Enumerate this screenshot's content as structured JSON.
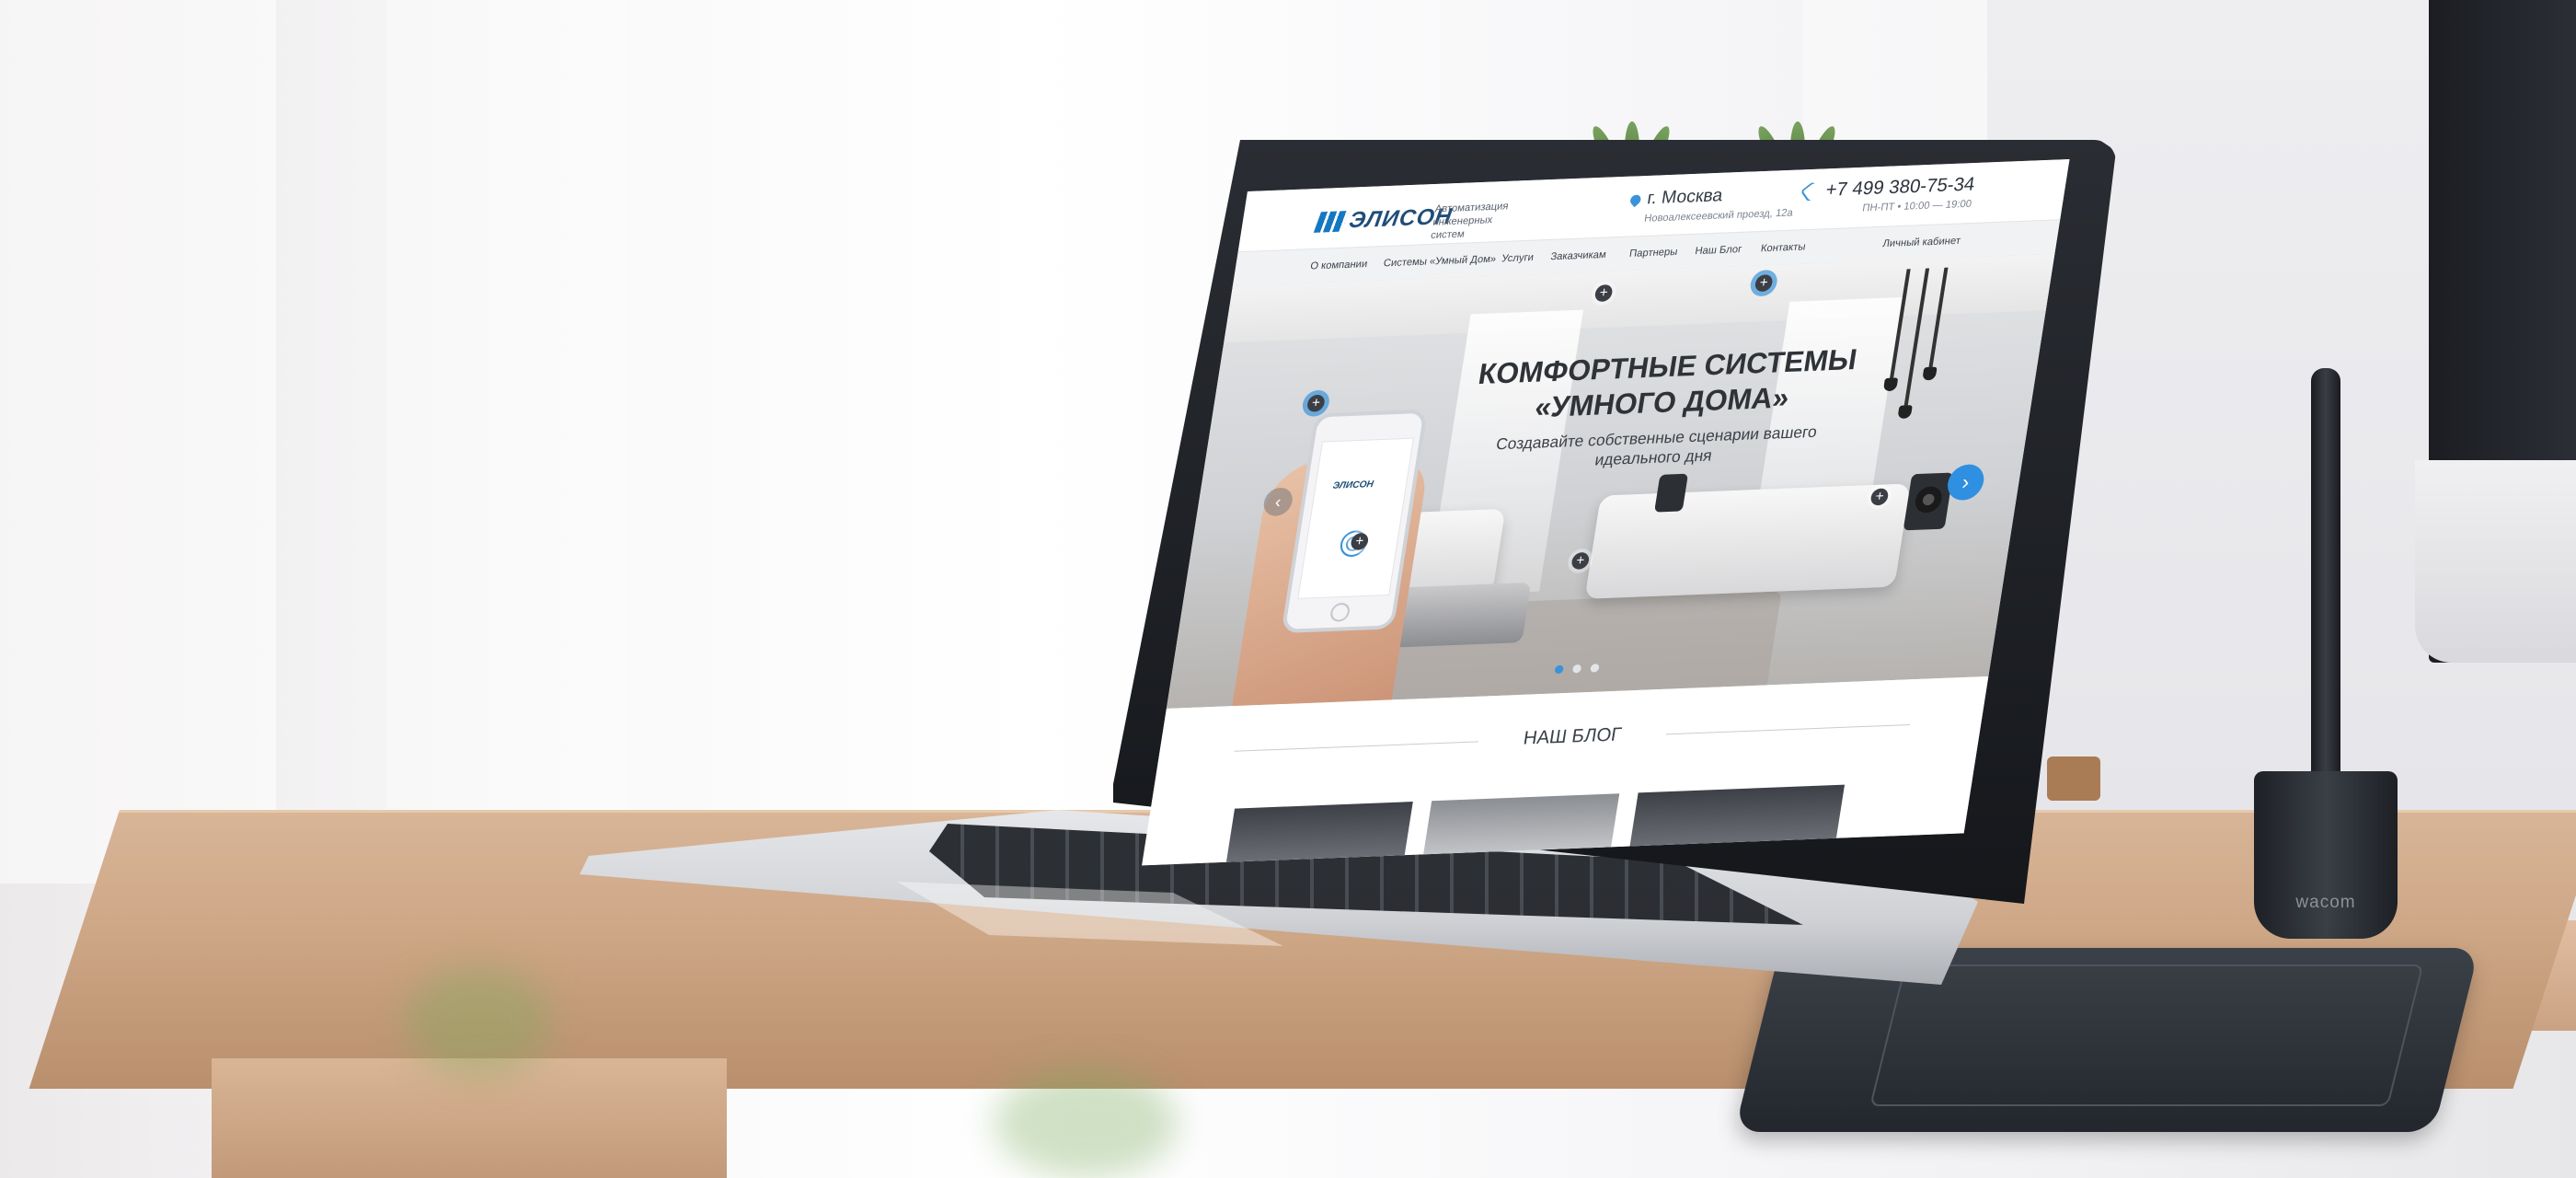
{
  "site": {
    "brand": "ЭЛИСОН",
    "tagline": "Автоматизация инженерных систем",
    "city": "г. Москва",
    "address": "Новоалексеевский проезд, 12а",
    "phone": "+7 499 380-75-34",
    "hours": "ПН-ПТ • 10:00 — 19:00",
    "nav": [
      "О компании",
      "Системы «Умный Дом»",
      "Услуги",
      "Заказчикам",
      "Партнеры",
      "Наш Блог",
      "Контакты"
    ],
    "account": "Личный кабинет",
    "hero": {
      "title": "КОМФОРТНЫЕ СИСТЕМЫ «УМНОГО ДОМА»",
      "subtitle": "Создавайте собственные сценарии вашего идеального дня",
      "phone_brand": "ЭЛИСОН",
      "slides_total": 3,
      "slide_active": 1
    },
    "blog_title": "НАШ БЛОГ"
  },
  "scene": {
    "pen_brand": "wacom"
  },
  "colors": {
    "accent": "#3a93d8",
    "brand": "#1f4d78"
  },
  "icons": [
    "pin-icon",
    "phone-icon",
    "hotspot-plus-icon",
    "arrow-left-icon",
    "arrow-right-icon",
    "fingerprint-icon"
  ]
}
